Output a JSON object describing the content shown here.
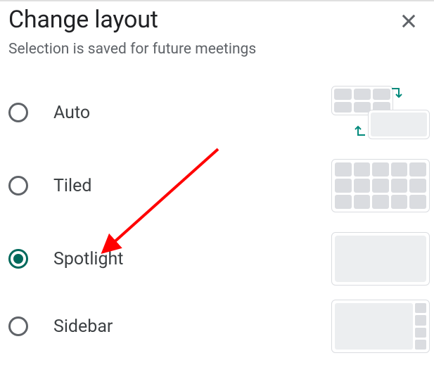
{
  "title": "Change layout",
  "subtitle": "Selection is saved for future meetings",
  "options": [
    {
      "label": "Auto",
      "selected": false
    },
    {
      "label": "Tiled",
      "selected": false
    },
    {
      "label": "Spotlight",
      "selected": true
    },
    {
      "label": "Sidebar",
      "selected": false
    }
  ]
}
